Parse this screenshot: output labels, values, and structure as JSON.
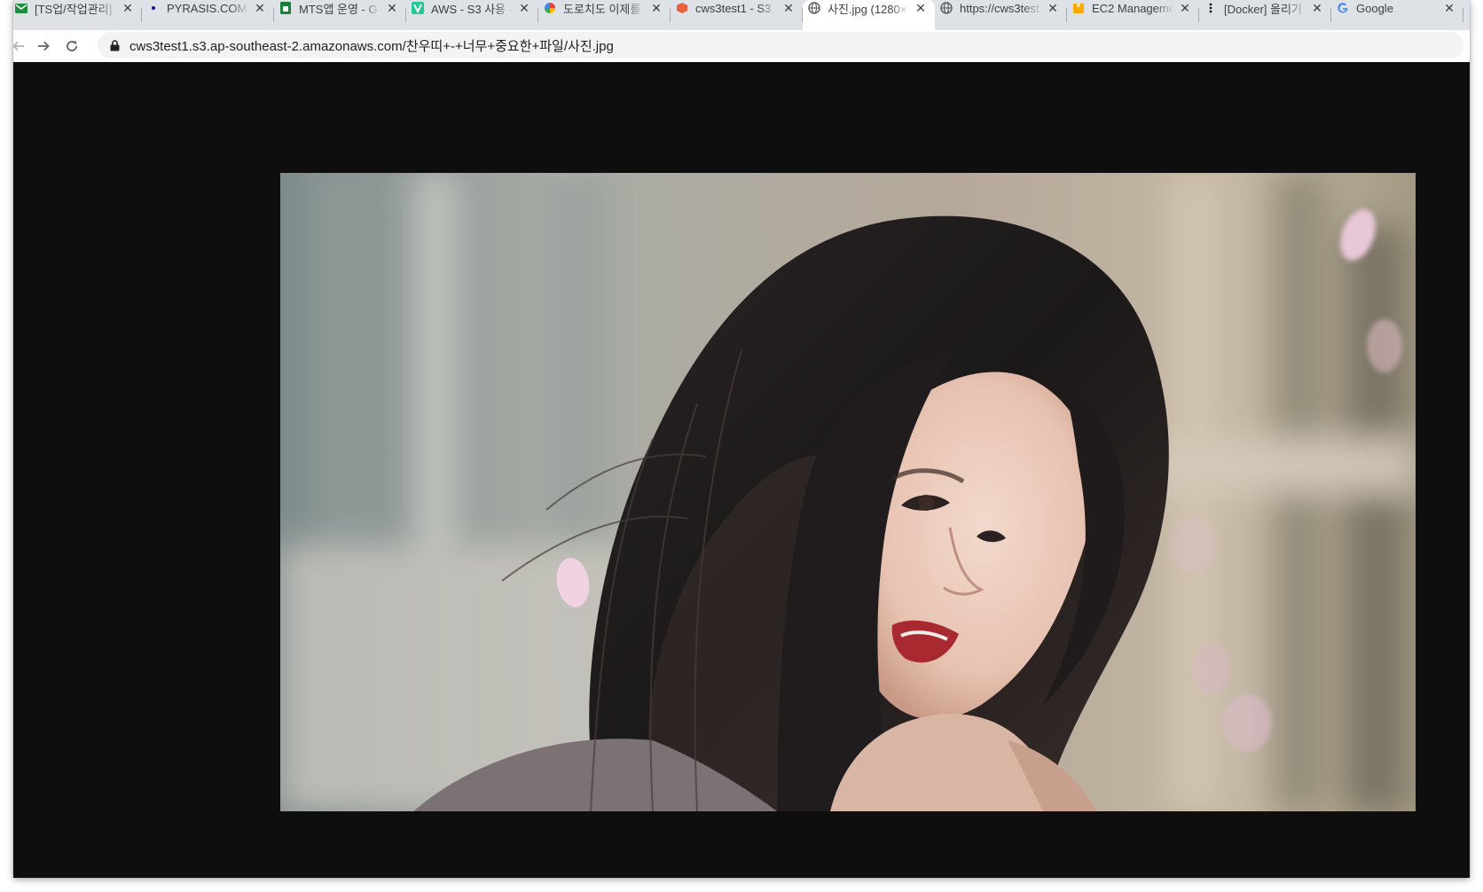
{
  "browser": {
    "tabs": [
      {
        "title": "[TS업/작업관리]",
        "favicon": "gmail-icon",
        "color": "#1e8e3e"
      },
      {
        "title": "PYRASIS.COM:",
        "favicon": "dot-icon",
        "color": "#1a0dab"
      },
      {
        "title": "MTS앱 운영 - G",
        "favicon": "sheets-icon",
        "color": "#188038"
      },
      {
        "title": "AWS - S3 사용 -",
        "favicon": "v-icon",
        "color": "#20c997"
      },
      {
        "title": "도로치도 이제를",
        "favicon": "pinwheel-icon",
        "color": "#4285f4"
      },
      {
        "title": "cws3test1 - S3",
        "favicon": "aws-cube-icon",
        "color": "#e8603c"
      },
      {
        "title": "사진.jpg (1280×",
        "favicon": "globe-icon",
        "color": "#5f6368",
        "active": true
      },
      {
        "title": "https://cws3test",
        "favicon": "globe-icon",
        "color": "#5f6368"
      },
      {
        "title": "EC2 Manageme",
        "favicon": "aws-box-icon",
        "color": "#f9ab00"
      },
      {
        "title": "[Docker] 올리기",
        "favicon": "kebab-icon",
        "color": "#202124"
      },
      {
        "title": "Google",
        "favicon": "google-icon",
        "color": "#4285f4"
      }
    ],
    "url": "cws3test1.s3.ap-southeast-2.amazonaws.com/찬우띠+-+너무+중요한+파일/사진.jpg"
  },
  "page": {
    "background": "#0e0e0e",
    "image_alt": "사진.jpg"
  }
}
